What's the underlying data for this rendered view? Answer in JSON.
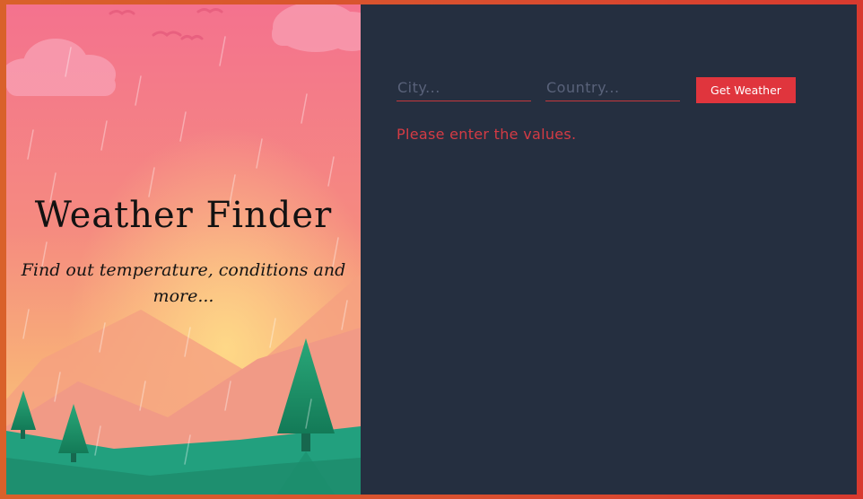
{
  "left_panel": {
    "title": "Weather Finder",
    "subtitle": "Find out temperature, conditions and more..."
  },
  "form": {
    "city_placeholder": "City...",
    "city_value": "",
    "country_placeholder": "Country...",
    "country_value": "",
    "submit_label": "Get Weather"
  },
  "status": {
    "error_message": "Please enter the values."
  },
  "colors": {
    "accent": "#e0353d",
    "panel_background": "#252f40",
    "error_text": "#d43b44"
  }
}
